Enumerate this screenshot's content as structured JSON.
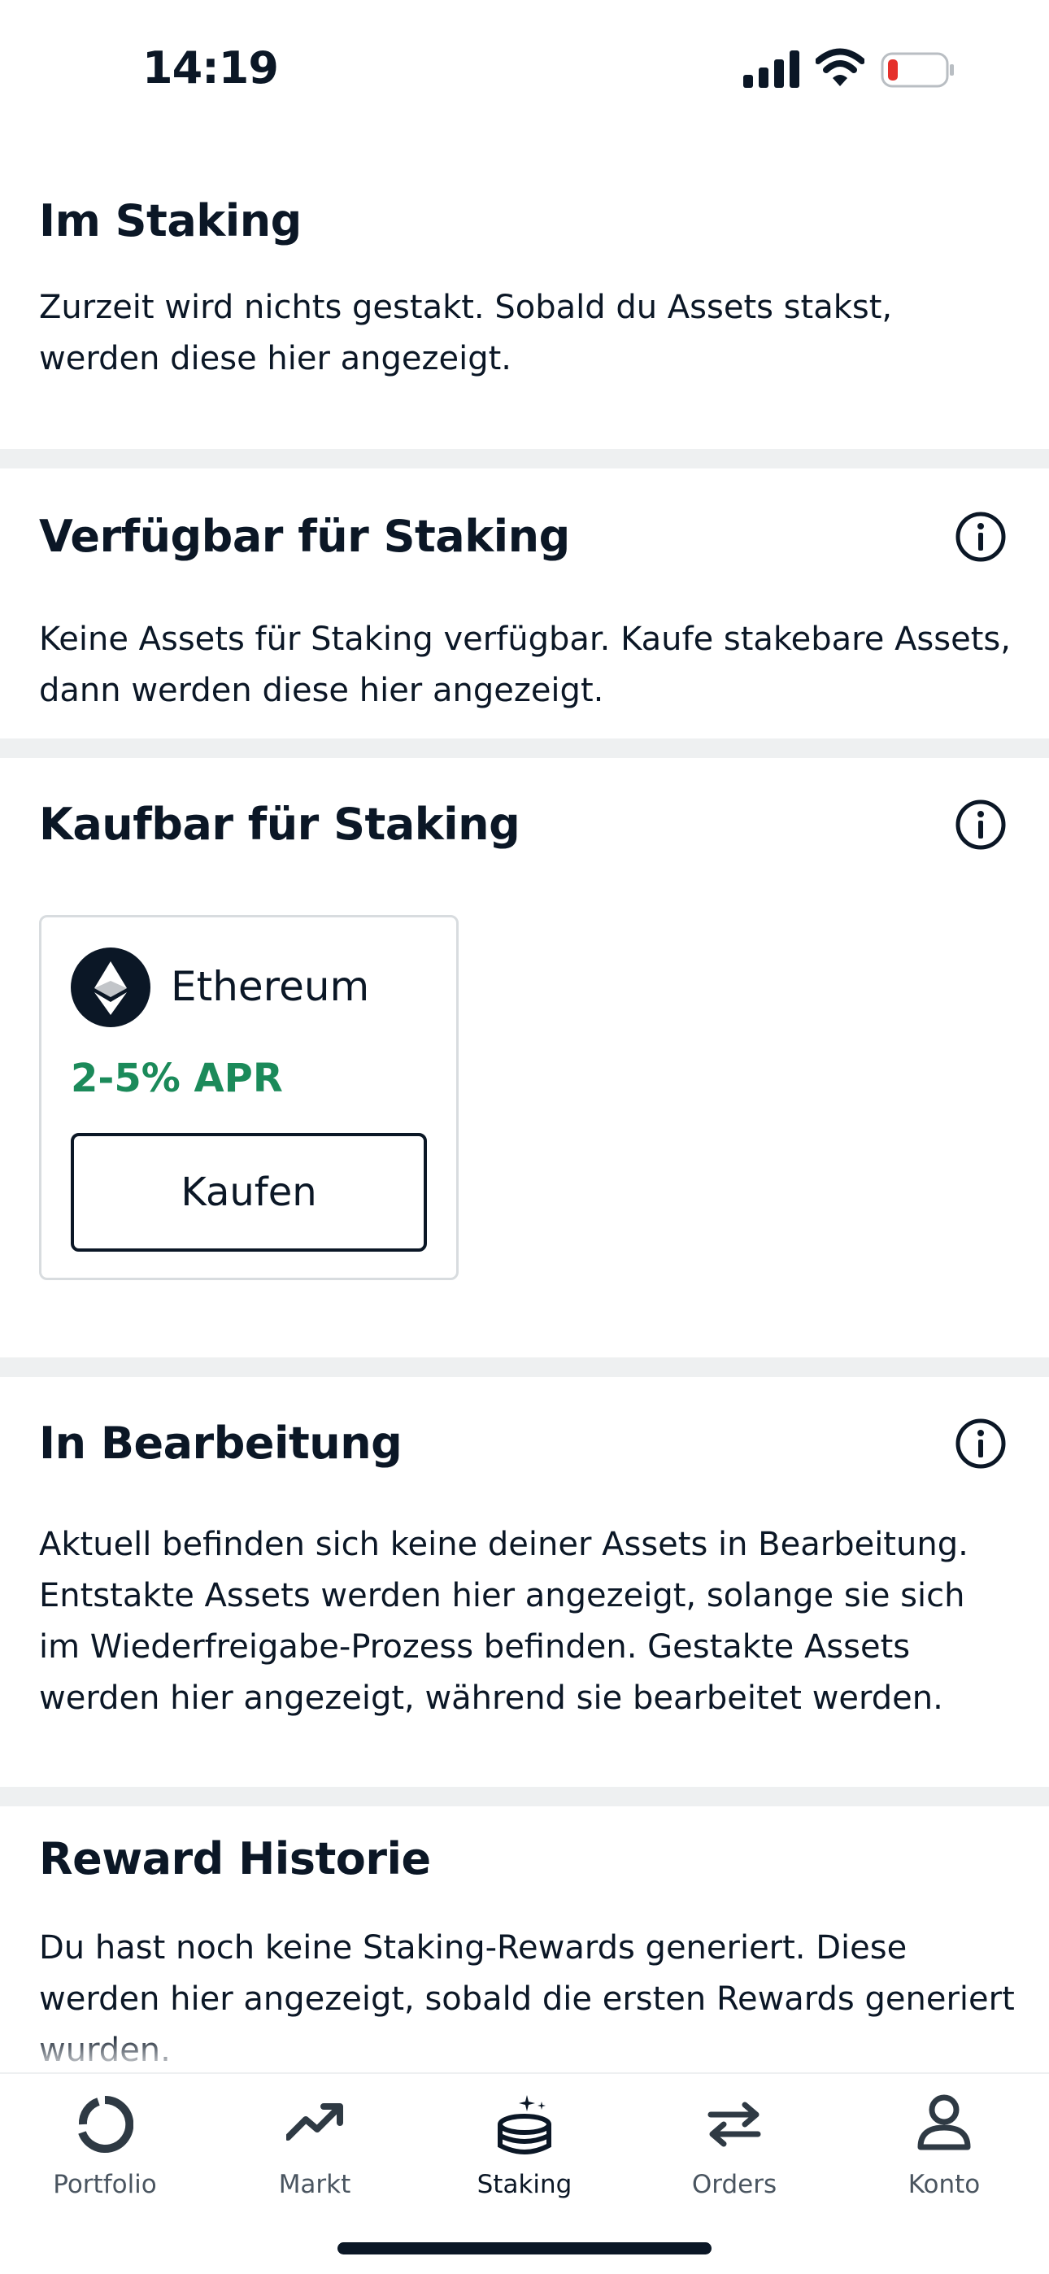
{
  "status_bar": {
    "time": "14:19"
  },
  "sections": {
    "staking": {
      "title": "Im Staking",
      "text": "Zurzeit wird nichts gestakt. Sobald du Assets stakst, werden diese hier angezeigt."
    },
    "available": {
      "title": "Verfügbar für Staking",
      "text": "Keine Assets für Staking verfügbar. Kaufe stakebare Assets, dann werden diese hier angezeigt."
    },
    "buyable": {
      "title": "Kaufbar für Staking",
      "asset": {
        "name": "Ethereum",
        "apr": "2-5% APR",
        "button_label": "Kaufen"
      }
    },
    "processing": {
      "title": "In Bearbeitung",
      "text": "Aktuell befinden sich keine deiner Assets in Bearbeitung. Entstakte Assets werden hier angezeigt, solange sie sich im Wiederfreigabe-Prozess befinden. Gestakte Assets werden hier angezeigt, während sie bearbeitet werden."
    },
    "rewards": {
      "title": "Reward Historie",
      "text": "Du hast noch keine Staking-Rewards generiert. Diese werden hier angezeigt, sobald die ersten Rewards generiert wurden."
    }
  },
  "tab_bar": {
    "items": [
      {
        "label": "Portfolio",
        "icon": "portfolio-icon"
      },
      {
        "label": "Markt",
        "icon": "trend-up-icon"
      },
      {
        "label": "Staking",
        "icon": "staking-coins-icon",
        "active": true
      },
      {
        "label": "Orders",
        "icon": "swap-arrows-icon"
      },
      {
        "label": "Konto",
        "icon": "person-icon"
      }
    ]
  },
  "colors": {
    "text": "#0b1726",
    "accent_green": "#1b8a5a",
    "divider": "#eef0f1",
    "battery_low": "#e5302b"
  }
}
